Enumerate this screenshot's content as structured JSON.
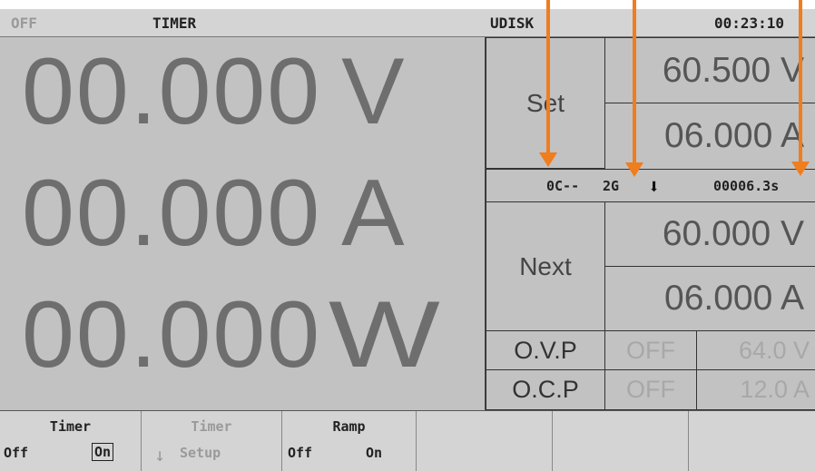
{
  "status_bar": {
    "output_state": "OFF",
    "mode": "TIMER",
    "storage": "UDISK",
    "clock": "00:23:10"
  },
  "readings": {
    "voltage": {
      "value": "00.000",
      "unit": "V"
    },
    "current": {
      "value": "00.000",
      "unit": "A"
    },
    "power": {
      "value": "00.000",
      "unit": "W"
    }
  },
  "set": {
    "label": "Set",
    "voltage": "60.500 V",
    "current": "06.000 A"
  },
  "timer_info": {
    "cycle": "0C--",
    "group": "2G",
    "direction_icon": "arrow-down-icon",
    "elapsed": "00006.3s"
  },
  "next": {
    "label": "Next",
    "voltage": "60.000 V",
    "current": "06.000 A"
  },
  "protection": {
    "ovp": {
      "label": "O.V.P",
      "state": "OFF",
      "value": "64.0 V"
    },
    "ocp": {
      "label": "O.C.P",
      "state": "OFF",
      "value": "12.0 A"
    }
  },
  "softkeys": {
    "timer": {
      "title": "Timer",
      "off": "Off",
      "on": "On",
      "selected": "On"
    },
    "timer_setup": {
      "title": "Timer",
      "sub": "Setup",
      "enabled": false
    },
    "ramp": {
      "title": "Ramp",
      "off": "Off",
      "on": "On"
    }
  },
  "annotation_color": "#f07d1e"
}
